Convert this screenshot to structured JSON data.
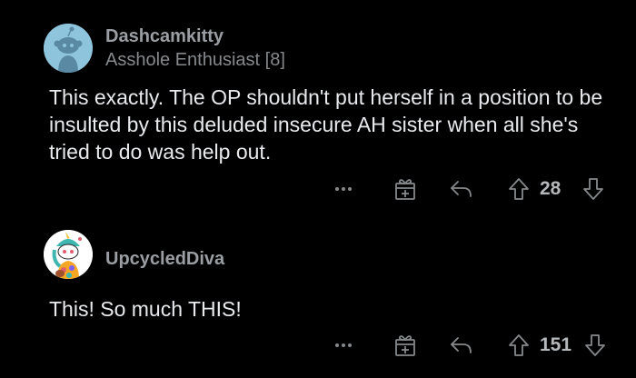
{
  "comments": [
    {
      "username": "Dashcamkitty",
      "flair": "Asshole Enthusiast [8]",
      "avatar_icon": "snoo-default-avatar-icon",
      "body": "This exactly. The OP shouldn't put herself in a position to be insulted by this deluded insecure AH sister when all she's tried to do was help out.",
      "score": "28"
    },
    {
      "username": "UpcycledDiva",
      "avatar_icon": "snoo-custom-avatar-icon",
      "body": "This!  So much THIS!",
      "score": "151"
    }
  ],
  "colors": {
    "background": "#000000",
    "username": "#9a9ea2",
    "body_text": "#e8eaed",
    "icon": "#86898c"
  }
}
